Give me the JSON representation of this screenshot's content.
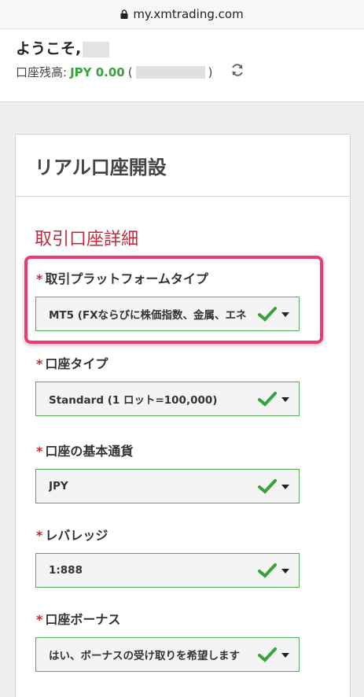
{
  "browser": {
    "url": "my.xmtrading.com"
  },
  "header": {
    "welcome": "ようこそ,",
    "balance_label": "口座残高:",
    "balance_value": "JPY 0.00",
    "paren_open": "(",
    "paren_close": ")"
  },
  "panel": {
    "title": "リアル口座開設",
    "section_title": "取引口座詳細",
    "required_mark": "*",
    "fields": [
      {
        "label": "取引プラットフォームタイプ",
        "value": "MT5 (FXならびに株価指数、金属、エネ"
      },
      {
        "label": "口座タイプ",
        "value": "Standard (1 ロット=100,000)"
      },
      {
        "label": "口座の基本通貨",
        "value": "JPY"
      },
      {
        "label": "レバレッジ",
        "value": "1:888"
      },
      {
        "label": "口座ボーナス",
        "value": "はい、ボーナスの受け取りを希望します"
      }
    ]
  },
  "colors": {
    "accent_red": "#c3283b",
    "valid_green": "#33a33a",
    "highlight_pink": "#ec3b6e"
  },
  "icons": {
    "lock": "lock-icon",
    "refresh": "refresh-icon",
    "check": "check-icon",
    "caret": "chevron-down-icon"
  }
}
